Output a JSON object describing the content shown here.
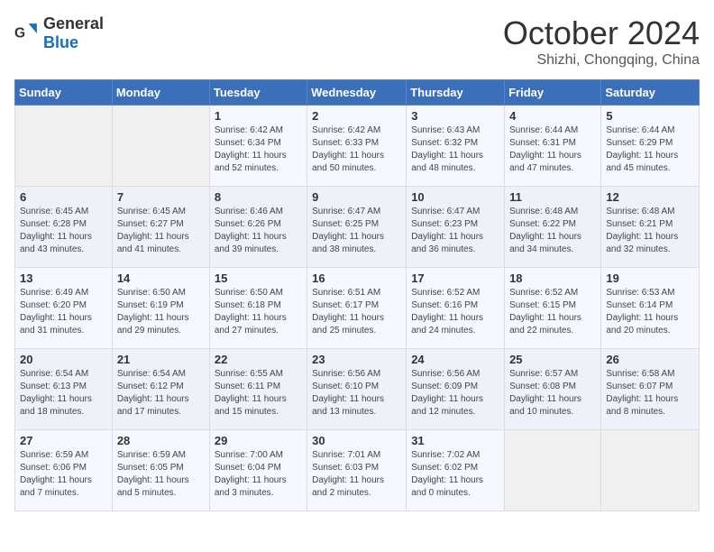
{
  "logo": {
    "general": "General",
    "blue": "Blue"
  },
  "title": {
    "month": "October 2024",
    "location": "Shizhi, Chongqing, China"
  },
  "weekdays": [
    "Sunday",
    "Monday",
    "Tuesday",
    "Wednesday",
    "Thursday",
    "Friday",
    "Saturday"
  ],
  "weeks": [
    [
      {
        "day": "",
        "empty": true
      },
      {
        "day": "",
        "empty": true
      },
      {
        "day": "1",
        "sunrise": "Sunrise: 6:42 AM",
        "sunset": "Sunset: 6:34 PM",
        "daylight": "Daylight: 11 hours and 52 minutes."
      },
      {
        "day": "2",
        "sunrise": "Sunrise: 6:42 AM",
        "sunset": "Sunset: 6:33 PM",
        "daylight": "Daylight: 11 hours and 50 minutes."
      },
      {
        "day": "3",
        "sunrise": "Sunrise: 6:43 AM",
        "sunset": "Sunset: 6:32 PM",
        "daylight": "Daylight: 11 hours and 48 minutes."
      },
      {
        "day": "4",
        "sunrise": "Sunrise: 6:44 AM",
        "sunset": "Sunset: 6:31 PM",
        "daylight": "Daylight: 11 hours and 47 minutes."
      },
      {
        "day": "5",
        "sunrise": "Sunrise: 6:44 AM",
        "sunset": "Sunset: 6:29 PM",
        "daylight": "Daylight: 11 hours and 45 minutes."
      }
    ],
    [
      {
        "day": "6",
        "sunrise": "Sunrise: 6:45 AM",
        "sunset": "Sunset: 6:28 PM",
        "daylight": "Daylight: 11 hours and 43 minutes."
      },
      {
        "day": "7",
        "sunrise": "Sunrise: 6:45 AM",
        "sunset": "Sunset: 6:27 PM",
        "daylight": "Daylight: 11 hours and 41 minutes."
      },
      {
        "day": "8",
        "sunrise": "Sunrise: 6:46 AM",
        "sunset": "Sunset: 6:26 PM",
        "daylight": "Daylight: 11 hours and 39 minutes."
      },
      {
        "day": "9",
        "sunrise": "Sunrise: 6:47 AM",
        "sunset": "Sunset: 6:25 PM",
        "daylight": "Daylight: 11 hours and 38 minutes."
      },
      {
        "day": "10",
        "sunrise": "Sunrise: 6:47 AM",
        "sunset": "Sunset: 6:23 PM",
        "daylight": "Daylight: 11 hours and 36 minutes."
      },
      {
        "day": "11",
        "sunrise": "Sunrise: 6:48 AM",
        "sunset": "Sunset: 6:22 PM",
        "daylight": "Daylight: 11 hours and 34 minutes."
      },
      {
        "day": "12",
        "sunrise": "Sunrise: 6:48 AM",
        "sunset": "Sunset: 6:21 PM",
        "daylight": "Daylight: 11 hours and 32 minutes."
      }
    ],
    [
      {
        "day": "13",
        "sunrise": "Sunrise: 6:49 AM",
        "sunset": "Sunset: 6:20 PM",
        "daylight": "Daylight: 11 hours and 31 minutes."
      },
      {
        "day": "14",
        "sunrise": "Sunrise: 6:50 AM",
        "sunset": "Sunset: 6:19 PM",
        "daylight": "Daylight: 11 hours and 29 minutes."
      },
      {
        "day": "15",
        "sunrise": "Sunrise: 6:50 AM",
        "sunset": "Sunset: 6:18 PM",
        "daylight": "Daylight: 11 hours and 27 minutes."
      },
      {
        "day": "16",
        "sunrise": "Sunrise: 6:51 AM",
        "sunset": "Sunset: 6:17 PM",
        "daylight": "Daylight: 11 hours and 25 minutes."
      },
      {
        "day": "17",
        "sunrise": "Sunrise: 6:52 AM",
        "sunset": "Sunset: 6:16 PM",
        "daylight": "Daylight: 11 hours and 24 minutes."
      },
      {
        "day": "18",
        "sunrise": "Sunrise: 6:52 AM",
        "sunset": "Sunset: 6:15 PM",
        "daylight": "Daylight: 11 hours and 22 minutes."
      },
      {
        "day": "19",
        "sunrise": "Sunrise: 6:53 AM",
        "sunset": "Sunset: 6:14 PM",
        "daylight": "Daylight: 11 hours and 20 minutes."
      }
    ],
    [
      {
        "day": "20",
        "sunrise": "Sunrise: 6:54 AM",
        "sunset": "Sunset: 6:13 PM",
        "daylight": "Daylight: 11 hours and 18 minutes."
      },
      {
        "day": "21",
        "sunrise": "Sunrise: 6:54 AM",
        "sunset": "Sunset: 6:12 PM",
        "daylight": "Daylight: 11 hours and 17 minutes."
      },
      {
        "day": "22",
        "sunrise": "Sunrise: 6:55 AM",
        "sunset": "Sunset: 6:11 PM",
        "daylight": "Daylight: 11 hours and 15 minutes."
      },
      {
        "day": "23",
        "sunrise": "Sunrise: 6:56 AM",
        "sunset": "Sunset: 6:10 PM",
        "daylight": "Daylight: 11 hours and 13 minutes."
      },
      {
        "day": "24",
        "sunrise": "Sunrise: 6:56 AM",
        "sunset": "Sunset: 6:09 PM",
        "daylight": "Daylight: 11 hours and 12 minutes."
      },
      {
        "day": "25",
        "sunrise": "Sunrise: 6:57 AM",
        "sunset": "Sunset: 6:08 PM",
        "daylight": "Daylight: 11 hours and 10 minutes."
      },
      {
        "day": "26",
        "sunrise": "Sunrise: 6:58 AM",
        "sunset": "Sunset: 6:07 PM",
        "daylight": "Daylight: 11 hours and 8 minutes."
      }
    ],
    [
      {
        "day": "27",
        "sunrise": "Sunrise: 6:59 AM",
        "sunset": "Sunset: 6:06 PM",
        "daylight": "Daylight: 11 hours and 7 minutes."
      },
      {
        "day": "28",
        "sunrise": "Sunrise: 6:59 AM",
        "sunset": "Sunset: 6:05 PM",
        "daylight": "Daylight: 11 hours and 5 minutes."
      },
      {
        "day": "29",
        "sunrise": "Sunrise: 7:00 AM",
        "sunset": "Sunset: 6:04 PM",
        "daylight": "Daylight: 11 hours and 3 minutes."
      },
      {
        "day": "30",
        "sunrise": "Sunrise: 7:01 AM",
        "sunset": "Sunset: 6:03 PM",
        "daylight": "Daylight: 11 hours and 2 minutes."
      },
      {
        "day": "31",
        "sunrise": "Sunrise: 7:02 AM",
        "sunset": "Sunset: 6:02 PM",
        "daylight": "Daylight: 11 hours and 0 minutes."
      },
      {
        "day": "",
        "empty": true
      },
      {
        "day": "",
        "empty": true
      }
    ]
  ]
}
